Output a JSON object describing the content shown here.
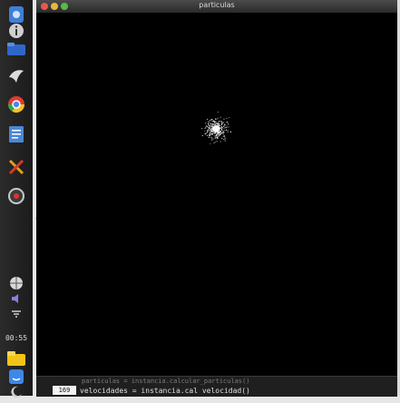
{
  "window": {
    "title": "particulas"
  },
  "clock": {
    "time": "00:55"
  },
  "terminal": {
    "prompt": "169",
    "line_faded": "particulas = instancia.calcular_particulas()",
    "line": "velocidades = instancia.cal velocidad()"
  },
  "colors": {
    "dock_bg": "#222222",
    "canvas_bg": "#000000",
    "particles": "#ffffff"
  }
}
